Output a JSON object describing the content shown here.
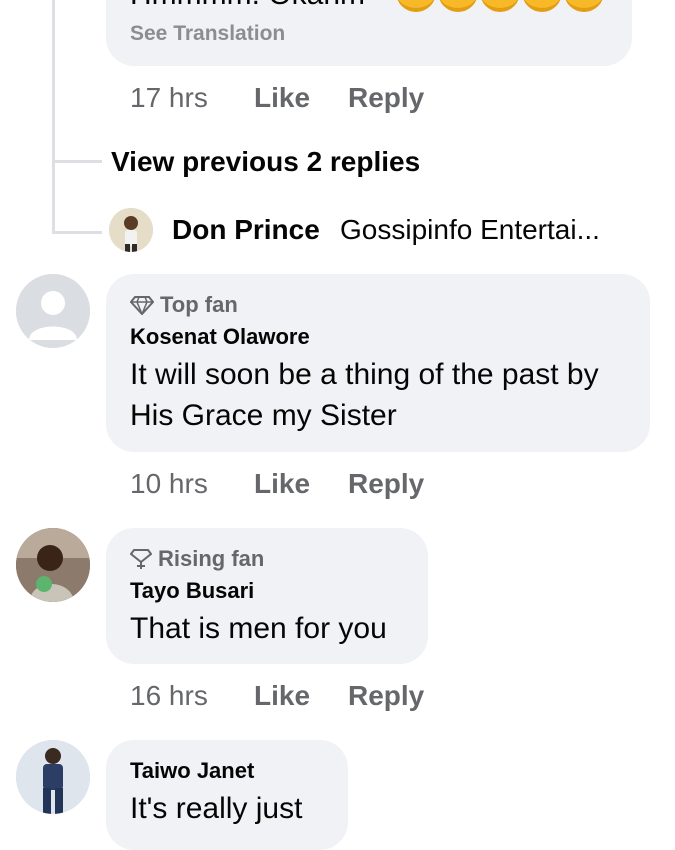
{
  "top_comment": {
    "cut_text": "Hmmmm. Okanm",
    "see_translation": "See Translation",
    "time": "17 hrs",
    "like": "Like",
    "reply": "Reply"
  },
  "thread": {
    "view_previous": "View previous 2 replies",
    "latest_reply": {
      "name": "Don Prince",
      "text": "Gossipinfo Entertai..."
    }
  },
  "comments": [
    {
      "badge": "Top fan",
      "badge_icon": "diamond-icon",
      "author": "Kosenat Olawore",
      "line1": "It will soon be a thing of the past by",
      "line2": "His Grace my Sister",
      "time": "10 hrs",
      "like": "Like",
      "reply": "Reply"
    },
    {
      "badge": "Rising fan",
      "badge_icon": "rising-diamond-icon",
      "author": "Tayo Busari",
      "line1": "That is men for you",
      "time": "16 hrs",
      "like": "Like",
      "reply": "Reply"
    },
    {
      "author": "Taiwo Janet",
      "line1": "It's really just"
    }
  ],
  "colors": {
    "bubble": "#f0f2f5",
    "meta_text": "#65676b",
    "primary_text": "#050505"
  }
}
